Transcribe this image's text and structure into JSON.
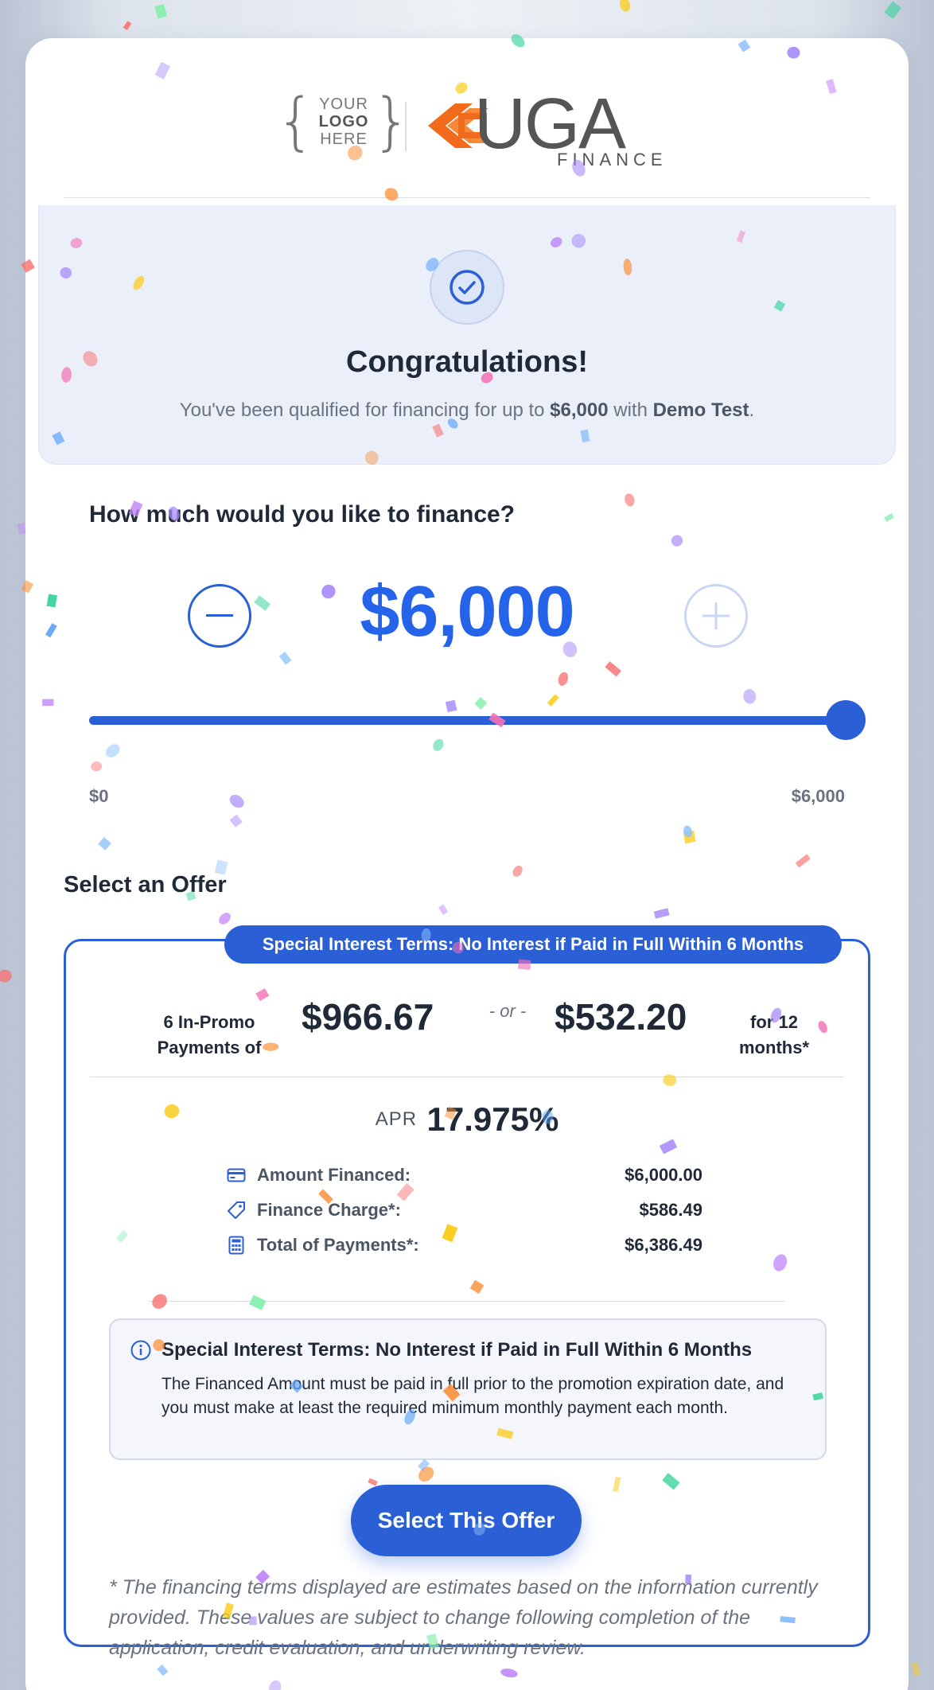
{
  "header": {
    "your_logo_line1": "YOUR",
    "your_logo_line2": "LOGO",
    "your_logo_line3": "HERE",
    "brand_main": "UGA",
    "brand_sub": "FINANCE"
  },
  "congrats": {
    "title": "Congratulations!",
    "sub_prefix": "You've been qualified for financing for up to ",
    "sub_amount": "$6,000",
    "sub_mid": " with ",
    "sub_merchant": "Demo Test",
    "sub_suffix": "."
  },
  "finance": {
    "question": "How much would you like to finance?",
    "amount": "$6,000",
    "slider_min": "$0",
    "slider_max": "$6,000",
    "slider_fraction": 1.0
  },
  "offers": {
    "section_title": "Select an Offer",
    "offer": {
      "badge": "Special Interest Terms: No Interest if Paid in Full Within 6 Months",
      "left_label": "6 In-Promo Payments of",
      "left_amount": "$966.67",
      "or_text": "- or -",
      "right_amount": "$532.20",
      "right_label": "for 12 months*",
      "apr_label": "APR",
      "apr_value": "17.975%",
      "details": [
        {
          "icon": "credit-card-icon",
          "label": "Amount Financed:",
          "value": "$6,000.00"
        },
        {
          "icon": "tag-icon",
          "label": "Finance Charge*:",
          "value": "$586.49"
        },
        {
          "icon": "calculator-icon",
          "label": "Total of Payments*:",
          "value": "$6,386.49"
        }
      ],
      "info_title": "Special Interest Terms: No Interest if Paid in Full Within 6 Months",
      "info_body": "The Financed Amount must be paid in full prior to the promotion expiration date, and you must make at least the required minimum monthly payment each month.",
      "button_label": "Select This Offer",
      "footnote": "* The financing terms displayed are estimates based on the information currently provided. These values are subject to change following completion of the application, credit evaluation, and underwriting review."
    }
  },
  "colors": {
    "accent": "#2a5fd6",
    "brand_orange": "#f26a1b",
    "brand_gray": "#555555"
  }
}
